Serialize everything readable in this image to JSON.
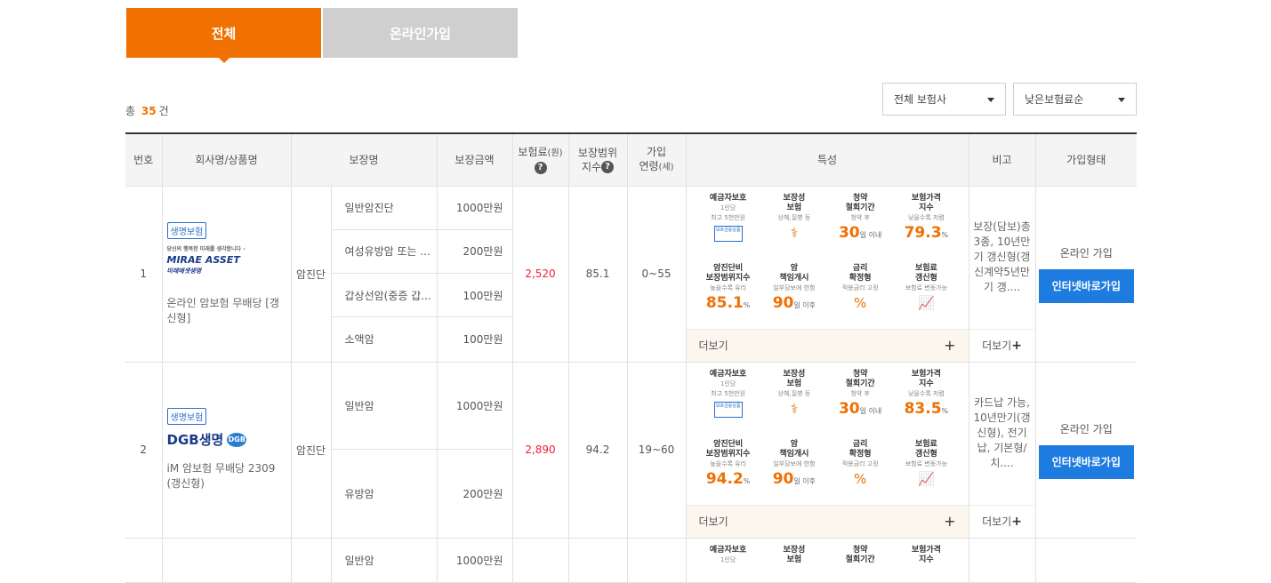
{
  "tabs": [
    {
      "label": "전체"
    },
    {
      "label": "온라인가입"
    }
  ],
  "total": {
    "prefix": "총",
    "count": "35",
    "suffix": "건"
  },
  "filters": {
    "company": "전체 보험사",
    "sort": "낮은보험료순"
  },
  "headers": {
    "no": "번호",
    "company": "회사명/상품명",
    "coverage": "보장명",
    "amount": "보장금액",
    "premium": "보험료",
    "premium_unit": "(원)",
    "index_line1": "보장범위",
    "index_line2": "지수",
    "age_line1": "가입",
    "age_line2": "연령",
    "age_unit": "(세)",
    "features": "특성",
    "note": "비고",
    "join": "가입형태"
  },
  "feature_labels": {
    "deposit": {
      "title1": "예금자보호",
      "sub1": "1인당",
      "sub2": "최고 5천만원",
      "badge": "보호금융상품"
    },
    "security": {
      "title1": "보장성",
      "title2": "보험",
      "sub": "상해,질병 등"
    },
    "withdraw": {
      "title1": "청약",
      "title2": "철회기간",
      "sub": "청약 후",
      "value": "30",
      "unit": "일 이내"
    },
    "price_index": {
      "title1": "보험가격",
      "title2": "지수",
      "sub": "낮을수록 저렴"
    },
    "cancer_index": {
      "title1": "암진단비",
      "title2": "보장범위지수",
      "sub": "높을수록 유리"
    },
    "cancer_start": {
      "title1": "암",
      "title2": "책임개시",
      "sub": "일부담보에 한함",
      "value": "90",
      "unit": "일 이후"
    },
    "rate": {
      "title1": "금리",
      "title2": "확정형",
      "sub": "적용금리 고정"
    },
    "renew": {
      "title1": "보험료",
      "title2": "갱신형",
      "sub": "보험료 변동가능"
    }
  },
  "more_label": "더보기",
  "note_more_label": "더보기",
  "rows": [
    {
      "no": "1",
      "tag": "생명보험",
      "logo": {
        "tagline": "당신의 행복한 미래를 생각합니다 -",
        "name": "MIRAE ASSET",
        "kr": "미래에셋생명"
      },
      "product": "온라인 암보험 무배당 [갱신형]",
      "category": "암진단",
      "coverages": [
        {
          "name": "일반암진단",
          "amount": "1000만원"
        },
        {
          "name": "여성유방암 또는 ...",
          "amount": "200만원"
        },
        {
          "name": "갑상선암(중증 갑...",
          "amount": "100만원"
        },
        {
          "name": "소액암",
          "amount": "100만원"
        }
      ],
      "premium": "2,520",
      "index": "85.1",
      "age": "0~55",
      "price_index": "79.3",
      "cancer_index": "85.1",
      "note": "보장(담보)총3종, 10년만기 갱신형(갱신계약5년만기 갱....",
      "join": "온라인 가입",
      "button": "인터넷바로가입"
    },
    {
      "no": "2",
      "tag": "생명보험",
      "logo": {
        "name": "DGB생명",
        "mark": "DGB"
      },
      "product": "iM 암보험 무배당 2309 (갱신형)",
      "category": "암진단",
      "coverages": [
        {
          "name": "일반암",
          "amount": "1000만원"
        },
        {
          "name": "유방암",
          "amount": "200만원"
        }
      ],
      "premium": "2,890",
      "index": "94.2",
      "age": "19~60",
      "price_index": "83.5",
      "cancer_index": "94.2",
      "note": "카드납 가능, 10년만기(갱신형), 전기납, 기본형/치....",
      "join": "온라인 가입",
      "button": "인터넷바로가입"
    },
    {
      "coverages": [
        {
          "name": "일반암",
          "amount": "1000만원"
        }
      ]
    }
  ],
  "colors": {
    "accent": "#f07000",
    "button": "#1e7be0",
    "tag": "#2a6ecb"
  }
}
